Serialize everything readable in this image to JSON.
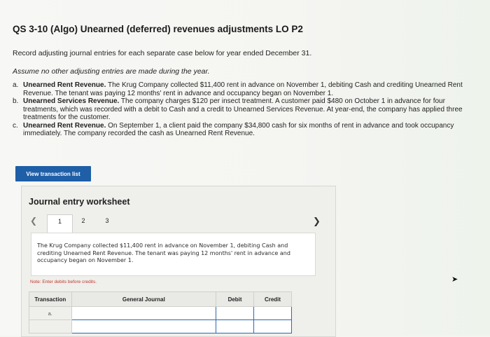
{
  "title": "QS 3-10 (Algo) Unearned (deferred) revenues adjustments LO P2",
  "instructions": {
    "record": "Record adjusting journal entries for each separate case below for year ended December 31.",
    "assume": "Assume no other adjusting entries are made during the year."
  },
  "cases": [
    {
      "letter": "a.",
      "heading": "Unearned Rent Revenue.",
      "text": " The Krug Company collected $11,400 rent in advance on November 1, debiting Cash and crediting Unearned Rent Revenue. The tenant was paying 12 months' rent in advance and occupancy began on November 1."
    },
    {
      "letter": "b.",
      "heading": "Unearned Services Revenue.",
      "text": " The company charges $120 per insect treatment. A customer paid $480 on October 1 in advance for four treatments, which was recorded with a debit to Cash and a credit to Unearned Services Revenue. At year-end, the company has applied three treatments for the customer."
    },
    {
      "letter": "c.",
      "heading": "Unearned Rent Revenue.",
      "text": " On September 1, a client paid the company $34,800 cash for six months of rent in advance and took occupancy immediately. The company recorded the cash as Unearned Rent Revenue."
    }
  ],
  "view_button": "View transaction list",
  "worksheet": {
    "title": "Journal entry worksheet",
    "tabs": [
      "1",
      "2",
      "3"
    ],
    "active_tab": "1",
    "prev_icon": "chevron-left-icon",
    "next_icon": "chevron-right-icon",
    "description": "The Krug Company collected $11,400 rent in advance on November 1, debiting Cash and crediting Unearned Rent Revenue. The tenant was paying 12 months' rent in advance and occupancy began on November 1.",
    "note": "Note: Enter debits before credits.",
    "columns": [
      "Transaction",
      "General Journal",
      "Debit",
      "Credit"
    ],
    "rows": [
      {
        "transaction": "a."
      },
      {
        "transaction": ""
      }
    ]
  },
  "colors": {
    "accent": "#1e5fa8",
    "note": "#c0392b",
    "input_border": "#2a6ab3"
  }
}
